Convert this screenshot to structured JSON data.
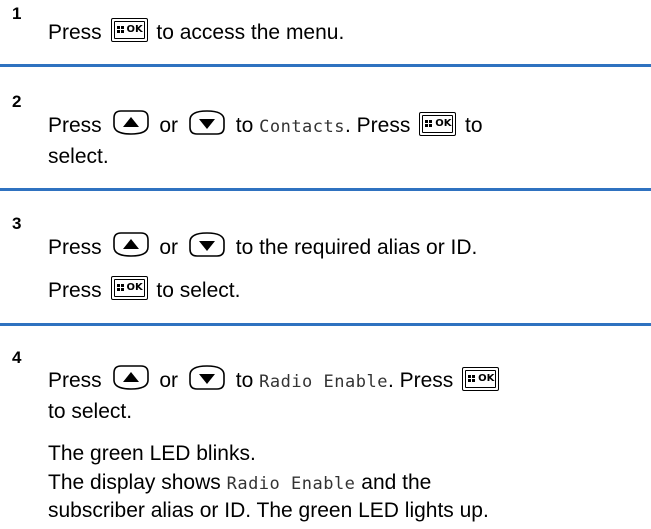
{
  "steps": [
    {
      "number": "1",
      "lines": [
        {
          "t1": "Press",
          "t2": "to access the menu."
        }
      ]
    },
    {
      "number": "2",
      "line1": {
        "press": "Press",
        "or": "or",
        "to": "to",
        "target": "Contacts",
        "press2": ". Press",
        "end": "to"
      },
      "line2": "select."
    },
    {
      "number": "3",
      "line1": {
        "press": "Press",
        "or": "or",
        "rest": "to the required alias or ID."
      },
      "line2": {
        "press": "Press",
        "rest": "to select."
      }
    },
    {
      "number": "4",
      "line1": {
        "press": "Press",
        "or": "or",
        "to": "to",
        "target": "Radio Enable",
        "press2": ". Press"
      },
      "line2": "to select.",
      "line3": "The green LED blinks.",
      "line4": {
        "pre": "The display shows",
        "target": "Radio Enable",
        "post": "and the"
      },
      "line5": "subscriber alias or ID. The green LED lights up."
    }
  ],
  "keys": {
    "ok_label": "OK",
    "ok_icon": "menu-ok-key-icon",
    "up_icon": "up-arrow-key-icon",
    "down_icon": "down-arrow-key-icon"
  },
  "colors": {
    "divider": "#2f72c0"
  }
}
